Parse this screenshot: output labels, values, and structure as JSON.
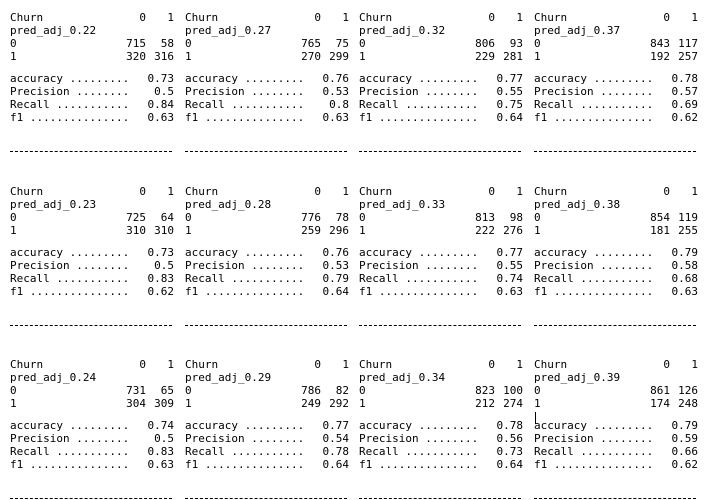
{
  "header_label": "Churn",
  "col_labels": [
    "0",
    "1"
  ],
  "row_labels": [
    "0",
    "1"
  ],
  "metric_names": [
    "accuracy .........",
    "Precision ........",
    "Recall ...........",
    "f1 ..............."
  ],
  "panels": [
    {
      "name": "pred_adj_0.22",
      "matrix": [
        [
          "715",
          "58"
        ],
        [
          "320",
          "316"
        ]
      ],
      "metrics": [
        "0.73",
        "0.5",
        "0.84",
        "0.63"
      ]
    },
    {
      "name": "pred_adj_0.27",
      "matrix": [
        [
          "765",
          "75"
        ],
        [
          "270",
          "299"
        ]
      ],
      "metrics": [
        "0.76",
        "0.53",
        "0.8",
        "0.63"
      ]
    },
    {
      "name": "pred_adj_0.32",
      "matrix": [
        [
          "806",
          "93"
        ],
        [
          "229",
          "281"
        ]
      ],
      "metrics": [
        "0.77",
        "0.55",
        "0.75",
        "0.64"
      ]
    },
    {
      "name": "pred_adj_0.37",
      "matrix": [
        [
          "843",
          "117"
        ],
        [
          "192",
          "257"
        ]
      ],
      "metrics": [
        "0.78",
        "0.57",
        "0.69",
        "0.62"
      ]
    },
    {
      "name": "pred_adj_0.23",
      "matrix": [
        [
          "725",
          "64"
        ],
        [
          "310",
          "310"
        ]
      ],
      "metrics": [
        "0.73",
        "0.5",
        "0.83",
        "0.62"
      ]
    },
    {
      "name": "pred_adj_0.28",
      "matrix": [
        [
          "776",
          "78"
        ],
        [
          "259",
          "296"
        ]
      ],
      "metrics": [
        "0.76",
        "0.53",
        "0.79",
        "0.64"
      ]
    },
    {
      "name": "pred_adj_0.33",
      "matrix": [
        [
          "813",
          "98"
        ],
        [
          "222",
          "276"
        ]
      ],
      "metrics": [
        "0.77",
        "0.55",
        "0.74",
        "0.63"
      ]
    },
    {
      "name": "pred_adj_0.38",
      "matrix": [
        [
          "854",
          "119"
        ],
        [
          "181",
          "255"
        ]
      ],
      "metrics": [
        "0.79",
        "0.58",
        "0.68",
        "0.63"
      ]
    },
    {
      "name": "pred_adj_0.24",
      "matrix": [
        [
          "731",
          "65"
        ],
        [
          "304",
          "309"
        ]
      ],
      "metrics": [
        "0.74",
        "0.5",
        "0.83",
        "0.63"
      ]
    },
    {
      "name": "pred_adj_0.29",
      "matrix": [
        [
          "786",
          "82"
        ],
        [
          "249",
          "292"
        ]
      ],
      "metrics": [
        "0.77",
        "0.54",
        "0.78",
        "0.64"
      ]
    },
    {
      "name": "pred_adj_0.34",
      "matrix": [
        [
          "823",
          "100"
        ],
        [
          "212",
          "274"
        ]
      ],
      "metrics": [
        "0.78",
        "0.56",
        "0.73",
        "0.64"
      ]
    },
    {
      "name": "pred_adj_0.39",
      "matrix": [
        [
          "861",
          "126"
        ],
        [
          "174",
          "248"
        ]
      ],
      "metrics": [
        "0.79",
        "0.59",
        "0.66",
        "0.62"
      ]
    }
  ]
}
